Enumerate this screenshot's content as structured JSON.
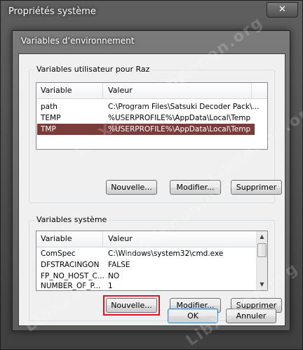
{
  "outer_window": {
    "title": "Propriétés système",
    "close_glyph": "✕"
  },
  "dialog": {
    "title": "Variables d’environnement"
  },
  "user_vars": {
    "group_label": "Variables utilisateur pour Raz",
    "columns": [
      "Variable",
      "Valeur"
    ],
    "rows": [
      {
        "variable": "path",
        "value": "C:\\Program Files\\Satsuki Decoder Pack\\..."
      },
      {
        "variable": "TEMP",
        "value": "%USERPROFILE%\\AppData\\Local\\Temp"
      },
      {
        "variable": "TMP",
        "value": "%USERPROFILE%\\AppData\\Local\\Temp"
      }
    ],
    "buttons": {
      "new": "Nouvelle...",
      "edit": "Modifier...",
      "delete": "Supprimer"
    }
  },
  "system_vars": {
    "group_label": "Variables système",
    "columns": [
      "Variable",
      "Valeur"
    ],
    "rows": [
      {
        "variable": "ComSpec",
        "value": "C:\\Windows\\system32\\cmd.exe"
      },
      {
        "variable": "DFSTRACINGON",
        "value": "FALSE"
      },
      {
        "variable": "FP_NO_HOST_C...",
        "value": "NO"
      },
      {
        "variable": "NUMBER_OF_P...",
        "value": "1"
      }
    ],
    "buttons": {
      "new": "Nouvelle...",
      "edit": "Modifier...",
      "delete": "Supprimer"
    }
  },
  "footer": {
    "ok": "OK",
    "cancel": "Annuler"
  },
  "watermark": {
    "text": "LibXenon.org"
  },
  "colors": {
    "selection": "#7a3b3b",
    "highlight": "#e0141e",
    "window": "#4f4f4f"
  }
}
